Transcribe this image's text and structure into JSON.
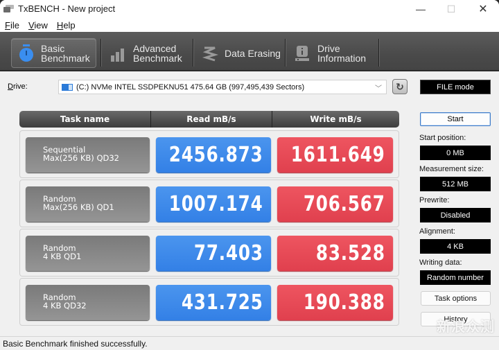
{
  "window": {
    "title": "TxBENCH - New project",
    "controls": {
      "minimize": "—",
      "maximize": "☐",
      "close": "✕"
    }
  },
  "menu": [
    {
      "label": "File",
      "mnemonic": "F",
      "rest": "ile"
    },
    {
      "label": "View",
      "mnemonic": "V",
      "rest": "iew"
    },
    {
      "label": "Help",
      "mnemonic": "H",
      "rest": "elp"
    }
  ],
  "toolbar": {
    "tabs": [
      {
        "line1": "Basic",
        "line2": "Benchmark",
        "icon": "stopwatch-icon",
        "active": true
      },
      {
        "line1": "Advanced",
        "line2": "Benchmark",
        "icon": "bar-chart-icon",
        "active": false
      },
      {
        "line1": "Data Erasing",
        "line2": "",
        "icon": "eraser-spring-icon",
        "active": false
      },
      {
        "line1": "Drive",
        "line2": "Information",
        "icon": "drive-info-icon",
        "active": false
      }
    ]
  },
  "drive": {
    "label": "Drive:",
    "selected": "(C:) NVMe INTEL SSDPEKNU51  475.64 GB (997,495,439 Sectors)",
    "refresh_icon": "↻",
    "mode": "FILE mode"
  },
  "table": {
    "headers": [
      "Task name",
      "Read mB/s",
      "Write mB/s"
    ],
    "rows": [
      {
        "task_line1": "Sequential",
        "task_line2": "Max(256 KB) QD32",
        "read": "2456.873",
        "write": "1611.649"
      },
      {
        "task_line1": "Random",
        "task_line2": "Max(256 KB) QD1",
        "read": "1007.174",
        "write": "706.567"
      },
      {
        "task_line1": "Random",
        "task_line2": "4 KB QD1",
        "read": "77.403",
        "write": "83.528"
      },
      {
        "task_line1": "Random",
        "task_line2": "4 KB QD32",
        "read": "431.725",
        "write": "190.388"
      }
    ]
  },
  "side": {
    "start": "Start",
    "start_position_label": "Start position:",
    "start_position": "0 MB",
    "measurement_size_label": "Measurement size:",
    "measurement_size": "512 MB",
    "prewrite_label": "Prewrite:",
    "prewrite": "Disabled",
    "alignment_label": "Alignment:",
    "alignment": "4 KB",
    "writing_data_label": "Writing data:",
    "writing_data": "Random number",
    "task_options": "Task options",
    "history": "History"
  },
  "status": "Basic Benchmark finished successfully.",
  "watermark": "新浪众测",
  "colors": {
    "read": "#3a86ea",
    "write": "#e5464f",
    "task": "#858585",
    "toolbar": "#4f4f4f",
    "active_icon": "#3a8ef0"
  }
}
